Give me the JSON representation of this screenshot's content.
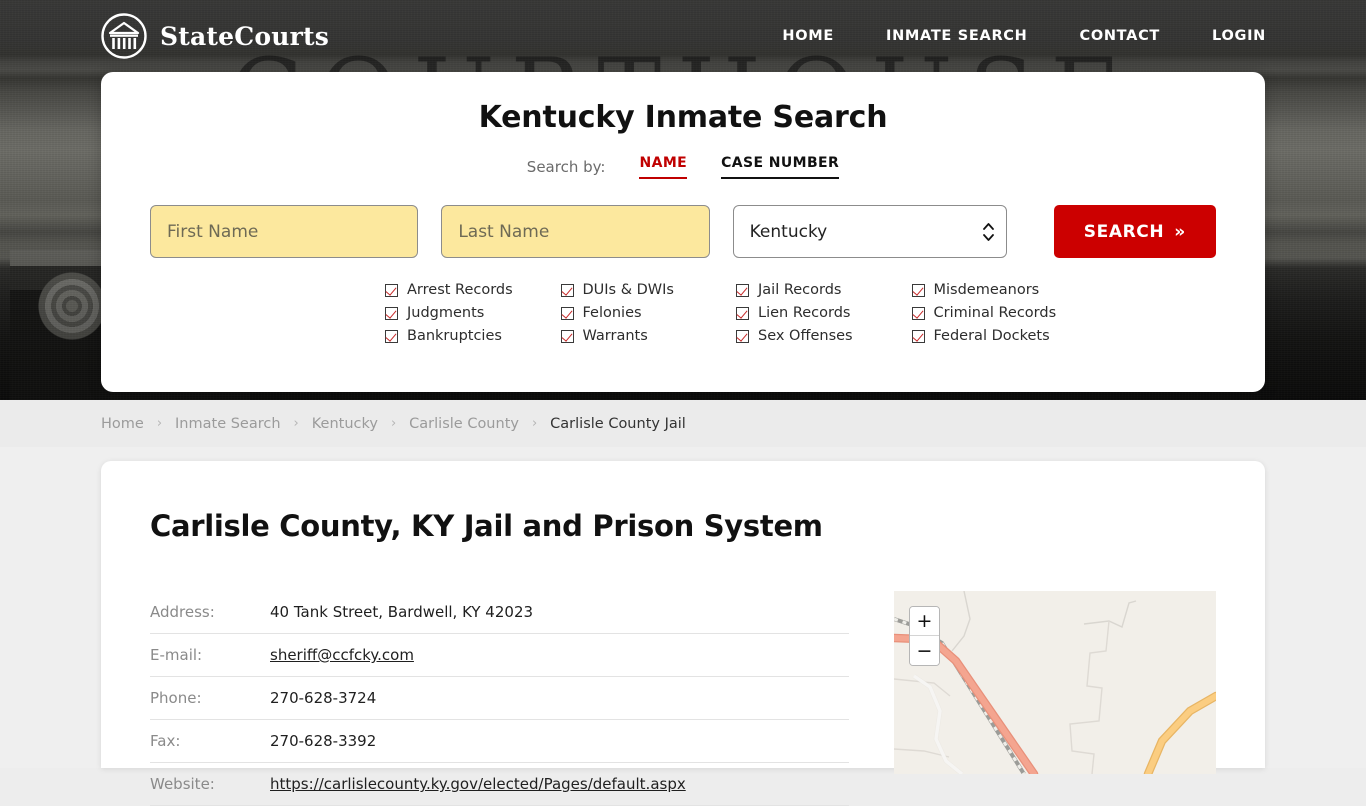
{
  "header": {
    "brand_name": "StateCourts",
    "logo_icon": "courthouse-circle-icon",
    "background_word": "COURTHOUSE",
    "nav": [
      {
        "label": "HOME"
      },
      {
        "label": "INMATE SEARCH"
      },
      {
        "label": "CONTACT"
      },
      {
        "label": "LOGIN"
      }
    ]
  },
  "search": {
    "title": "Kentucky Inmate Search",
    "search_by_label": "Search by:",
    "tabs": [
      {
        "label": "NAME",
        "active": true
      },
      {
        "label": "CASE NUMBER",
        "active": false
      }
    ],
    "first_name_placeholder": "First Name",
    "first_name_value": "",
    "last_name_placeholder": "Last Name",
    "last_name_value": "",
    "state_selected": "Kentucky",
    "state_options": [
      "Kentucky"
    ],
    "submit_label": "SEARCH",
    "submit_chevron": "»",
    "accent_red": "#cc0000",
    "input_yellow": "#fce89e",
    "features": [
      "Arrest Records",
      "DUIs & DWIs",
      "Jail Records",
      "Misdemeanors",
      "Judgments",
      "Felonies",
      "Lien Records",
      "Criminal Records",
      "Bankruptcies",
      "Warrants",
      "Sex Offenses",
      "Federal Dockets"
    ]
  },
  "breadcrumb": {
    "separator": "›",
    "items": [
      {
        "label": "Home",
        "current": false
      },
      {
        "label": "Inmate Search",
        "current": false
      },
      {
        "label": "Kentucky",
        "current": false
      },
      {
        "label": "Carlisle County",
        "current": false
      },
      {
        "label": "Carlisle County Jail",
        "current": true
      }
    ]
  },
  "main": {
    "page_title": "Carlisle County, KY Jail and Prison System",
    "info_rows": [
      {
        "label": "Address:",
        "value": "40 Tank Street, Bardwell, KY 42023",
        "link": false
      },
      {
        "label": "E-mail:",
        "value": "sheriff@ccfcky.com",
        "link": true
      },
      {
        "label": "Phone:",
        "value": "270-628-3724",
        "link": false
      },
      {
        "label": "Fax:",
        "value": "270-628-3392",
        "link": false
      },
      {
        "label": "Website:",
        "value": "https://carlislecounty.ky.gov/elected/Pages/default.aspx",
        "link": true
      }
    ]
  },
  "map": {
    "zoom_in_label": "+",
    "zoom_out_label": "−",
    "background_color": "#f2efe9",
    "primary_road_color": "#f4a08a",
    "secondary_road_color": "#fbc87d"
  }
}
